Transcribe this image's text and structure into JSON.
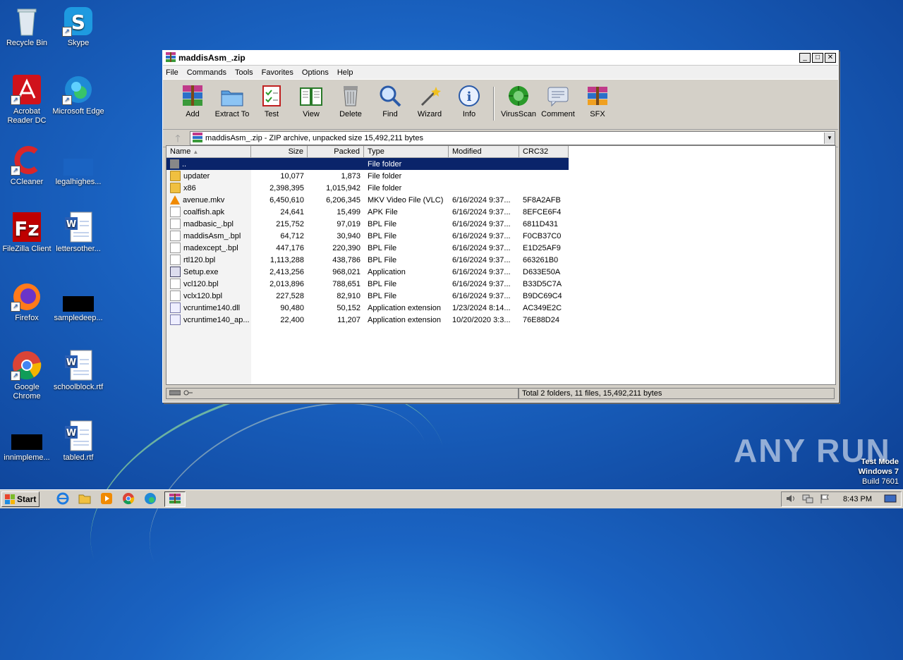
{
  "desktop": {
    "icons": [
      {
        "label": "Recycle Bin"
      },
      {
        "label": "Skype"
      },
      {
        "label": "Acrobat Reader DC"
      },
      {
        "label": "Microsoft Edge"
      },
      {
        "label": "CCleaner"
      },
      {
        "label": "legalhighes..."
      },
      {
        "label": "FileZilla Client"
      },
      {
        "label": "lettersother..."
      },
      {
        "label": "Firefox"
      },
      {
        "label": "sampledeep..."
      },
      {
        "label": "Google Chrome"
      },
      {
        "label": "schoolblock.rtf"
      },
      {
        "label": "innimpleme..."
      },
      {
        "label": "tabled.rtf"
      }
    ],
    "watermark": "ANY RUN",
    "test_mode": {
      "line1": "Test Mode",
      "line2": "Windows 7",
      "line3": "Build 7601"
    }
  },
  "window": {
    "title": "maddisAsm_.zip",
    "menu": [
      "File",
      "Commands",
      "Tools",
      "Favorites",
      "Options",
      "Help"
    ],
    "toolbar": [
      {
        "label": "Add",
        "icon": "add-icon"
      },
      {
        "label": "Extract To",
        "icon": "extract-icon"
      },
      {
        "label": "Test",
        "icon": "test-icon"
      },
      {
        "label": "View",
        "icon": "view-icon"
      },
      {
        "label": "Delete",
        "icon": "delete-icon"
      },
      {
        "label": "Find",
        "icon": "find-icon"
      },
      {
        "label": "Wizard",
        "icon": "wizard-icon"
      },
      {
        "label": "Info",
        "icon": "info-icon"
      },
      {
        "label": "VirusScan",
        "icon": "virusscan-icon"
      },
      {
        "label": "Comment",
        "icon": "comment-icon"
      },
      {
        "label": "SFX",
        "icon": "sfx-icon"
      }
    ],
    "address": "maddisAsm_.zip - ZIP archive, unpacked size 15,492,211 bytes",
    "columns": {
      "name": "Name",
      "size": "Size",
      "packed": "Packed",
      "type": "Type",
      "modified": "Modified",
      "crc": "CRC32"
    },
    "rows": [
      {
        "name": "..",
        "size": "",
        "packed": "",
        "type": "File folder",
        "modified": "",
        "crc": "",
        "icon": "up"
      },
      {
        "name": "updater",
        "size": "10,077",
        "packed": "1,873",
        "type": "File folder",
        "modified": "",
        "crc": "",
        "icon": "folder"
      },
      {
        "name": "x86",
        "size": "2,398,395",
        "packed": "1,015,942",
        "type": "File folder",
        "modified": "",
        "crc": "",
        "icon": "folder"
      },
      {
        "name": "avenue.mkv",
        "size": "6,450,610",
        "packed": "6,206,345",
        "type": "MKV Video File (VLC)",
        "modified": "6/16/2024 9:37...",
        "crc": "5F8A2AFB",
        "icon": "vlc"
      },
      {
        "name": "coalfish.apk",
        "size": "24,641",
        "packed": "15,499",
        "type": "APK File",
        "modified": "6/16/2024 9:37...",
        "crc": "8EFCE6F4",
        "icon": "file"
      },
      {
        "name": "madbasic_.bpl",
        "size": "215,752",
        "packed": "97,019",
        "type": "BPL File",
        "modified": "6/16/2024 9:37...",
        "crc": "6811D431",
        "icon": "file"
      },
      {
        "name": "maddisAsm_.bpl",
        "size": "64,712",
        "packed": "30,940",
        "type": "BPL File",
        "modified": "6/16/2024 9:37...",
        "crc": "F0CB37C0",
        "icon": "file"
      },
      {
        "name": "madexcept_.bpl",
        "size": "447,176",
        "packed": "220,390",
        "type": "BPL File",
        "modified": "6/16/2024 9:37...",
        "crc": "E1D25AF9",
        "icon": "file"
      },
      {
        "name": "rtl120.bpl",
        "size": "1,113,288",
        "packed": "438,786",
        "type": "BPL File",
        "modified": "6/16/2024 9:37...",
        "crc": "663261B0",
        "icon": "file"
      },
      {
        "name": "Setup.exe",
        "size": "2,413,256",
        "packed": "968,021",
        "type": "Application",
        "modified": "6/16/2024 9:37...",
        "crc": "D633E50A",
        "icon": "exe"
      },
      {
        "name": "vcl120.bpl",
        "size": "2,013,896",
        "packed": "788,651",
        "type": "BPL File",
        "modified": "6/16/2024 9:37...",
        "crc": "B33D5C7A",
        "icon": "file"
      },
      {
        "name": "vclx120.bpl",
        "size": "227,528",
        "packed": "82,910",
        "type": "BPL File",
        "modified": "6/16/2024 9:37...",
        "crc": "B9DC69C4",
        "icon": "file"
      },
      {
        "name": "vcruntime140.dll",
        "size": "90,480",
        "packed": "50,152",
        "type": "Application extension",
        "modified": "1/23/2024 8:14...",
        "crc": "AC349E2C",
        "icon": "dll"
      },
      {
        "name": "vcruntime140_ap...",
        "size": "22,400",
        "packed": "11,207",
        "type": "Application extension",
        "modified": "10/20/2020 3:3...",
        "crc": "76E88D24",
        "icon": "dll"
      }
    ],
    "status": "Total 2 folders, 11 files, 15,492,211 bytes"
  },
  "taskbar": {
    "start": "Start",
    "clock": "8:43 PM"
  }
}
